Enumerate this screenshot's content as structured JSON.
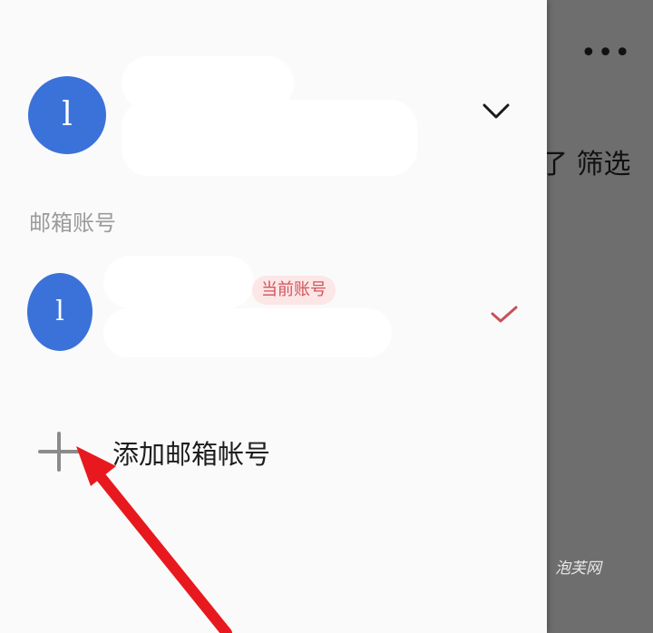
{
  "background_app": {
    "more_icon": "more-horizontal-icon",
    "more_glyph": "•••",
    "filter_text": "了 筛选"
  },
  "drawer": {
    "primary_account": {
      "avatar_letter": "l",
      "chevron_icon": "chevron-down-icon"
    },
    "section_label": "邮箱账号",
    "accounts": [
      {
        "avatar_letter": "l",
        "badge": "当前账号",
        "check_icon": "checkmark-icon",
        "check_color": "#c8505a"
      }
    ],
    "add_account": {
      "icon": "plus-icon",
      "label": "添加邮箱帐号"
    }
  },
  "annotation": {
    "arrow_color": "#e8191e"
  },
  "watermark": "泡芙网",
  "colors": {
    "avatar": "#3b72d9",
    "badge_bg": "#fde6e6",
    "badge_text": "#d1545b",
    "overlay": "#6e6e6e"
  }
}
